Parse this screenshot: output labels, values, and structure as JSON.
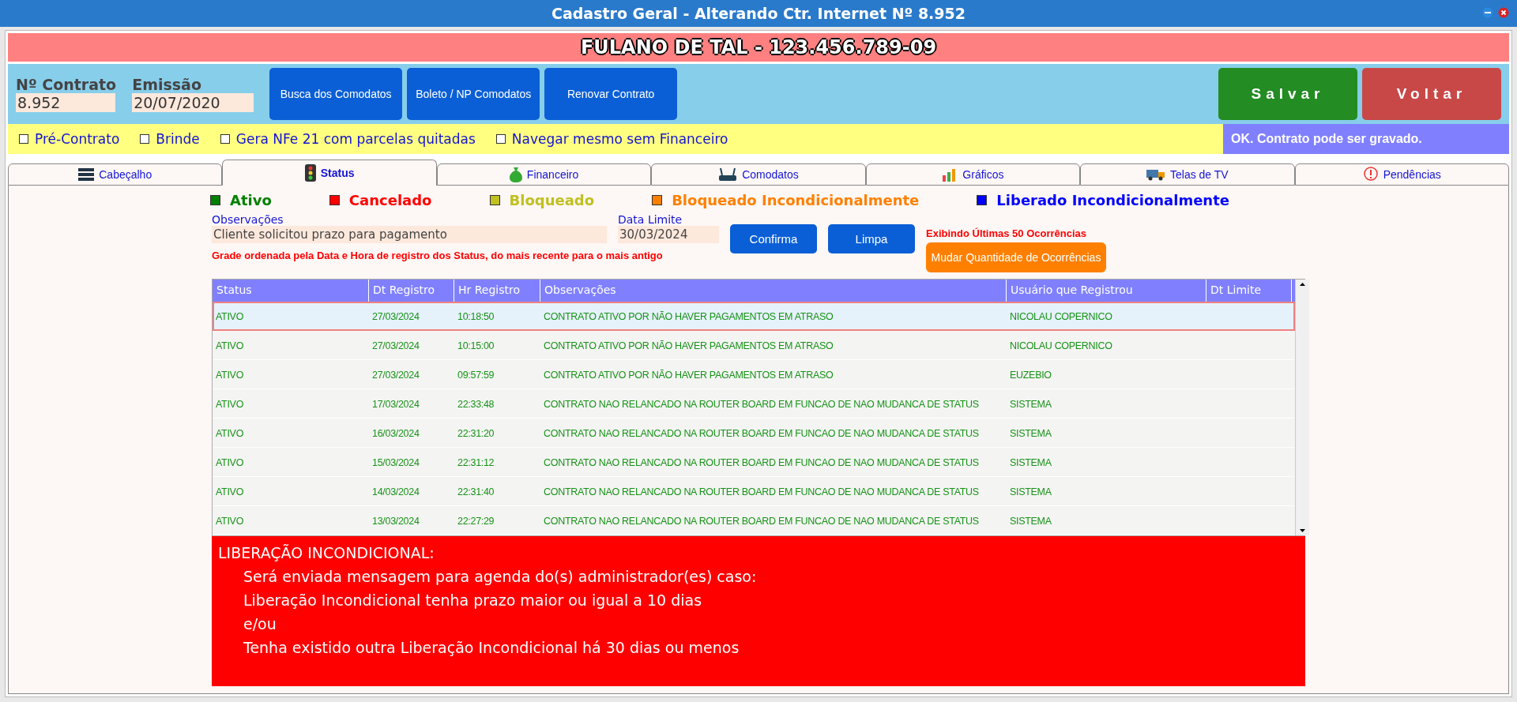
{
  "window": {
    "title": "Cadastro Geral - Alterando Ctr. Internet Nº 8.952"
  },
  "client_banner": "FULANO DE TAL - 123.456.789-09",
  "header": {
    "fields": [
      {
        "label": "Nº Contrato",
        "value": "8.952"
      },
      {
        "label": "Emissão",
        "value": "20/07/2020"
      }
    ],
    "buttons": [
      "Busca dos Comodatos",
      "Boleto / NP Comodatos",
      "Renovar Contrato"
    ],
    "save_button": "Salvar",
    "back_button": "Voltar"
  },
  "options": [
    {
      "label": "Pré-Contrato",
      "checked": false
    },
    {
      "label": "Brinde",
      "checked": false
    },
    {
      "label": "Gera NFe 21 com parcelas quitadas",
      "checked": false
    },
    {
      "label": "Navegar mesmo sem Financeiro",
      "checked": false
    }
  ],
  "status_message": "OK. Contrato pode ser gravado.",
  "tabs": [
    {
      "label": "Cabeçalho",
      "selected": false
    },
    {
      "label": "Status",
      "selected": true
    },
    {
      "label": "Financeiro",
      "selected": false
    },
    {
      "label": "Comodatos",
      "selected": false
    },
    {
      "label": "Gráficos",
      "selected": false
    },
    {
      "label": "Telas de TV",
      "selected": false
    },
    {
      "label": "Pendências",
      "selected": false
    }
  ],
  "legend": [
    {
      "label": "Ativo",
      "color": "#008000"
    },
    {
      "label": "Cancelado",
      "color": "#ff0000"
    },
    {
      "label": "Bloqueado",
      "color": "#c0c020"
    },
    {
      "label": "Bloqueado Incondicionalmente",
      "color": "#ff8000"
    },
    {
      "label": "Liberado Incondicionalmente",
      "color": "#0000ff"
    }
  ],
  "observacoes": {
    "label": "Observações",
    "value": "Cliente solicitou prazo para pagamento"
  },
  "data_limite": {
    "label": "Data Limite",
    "value": "30/03/2024"
  },
  "confirm_button": "Confirma",
  "clear_button": "Limpa",
  "occurrences_note": "Exibindo Últimas 50 Ocorrências",
  "change_quantity_button": "Mudar Quantidade de Ocorrências",
  "grid_note": "Grade ordenada pela Data e Hora de registro dos Status, do mais recente para o mais antigo",
  "table": {
    "columns": [
      "Status",
      "Dt Registro",
      "Hr Registro",
      "Observações",
      "Usuário que Registrou",
      "Dt Limite"
    ],
    "rows": [
      {
        "cells": [
          "ATIVO",
          "27/03/2024",
          "10:18:50",
          "CONTRATO ATIVO POR NÃO HAVER PAGAMENTOS EM ATRASO",
          "NICOLAU COPERNICO"
        ],
        "selected": true
      },
      {
        "cells": [
          "ATIVO",
          "27/03/2024",
          "10:15:00",
          "CONTRATO ATIVO POR NÃO HAVER PAGAMENTOS EM ATRASO",
          "NICOLAU COPERNICO"
        ],
        "selected": false
      },
      {
        "cells": [
          "ATIVO",
          "27/03/2024",
          "09:57:59",
          "CONTRATO ATIVO POR NÃO HAVER PAGAMENTOS EM ATRASO",
          "EUZEBIO"
        ],
        "selected": false
      },
      {
        "cells": [
          "ATIVO",
          "17/03/2024",
          "22:33:48",
          "CONTRATO NAO RELANCADO NA ROUTER BOARD EM FUNCAO DE NAO MUDANCA DE STATUS",
          "SISTEMA"
        ],
        "selected": false
      },
      {
        "cells": [
          "ATIVO",
          "16/03/2024",
          "22:31:20",
          "CONTRATO NAO RELANCADO NA ROUTER BOARD EM FUNCAO DE NAO MUDANCA DE STATUS",
          "SISTEMA"
        ],
        "selected": false
      },
      {
        "cells": [
          "ATIVO",
          "15/03/2024",
          "22:31:12",
          "CONTRATO NAO RELANCADO NA ROUTER BOARD EM FUNCAO DE NAO MUDANCA DE STATUS",
          "SISTEMA"
        ],
        "selected": false
      },
      {
        "cells": [
          "ATIVO",
          "14/03/2024",
          "22:31:40",
          "CONTRATO NAO RELANCADO NA ROUTER BOARD EM FUNCAO DE NAO MUDANCA DE STATUS",
          "SISTEMA"
        ],
        "selected": false
      },
      {
        "cells": [
          "ATIVO",
          "13/03/2024",
          "22:27:29",
          "CONTRATO NAO RELANCADO NA ROUTER BOARD EM FUNCAO DE NAO MUDANCA DE STATUS",
          "SISTEMA"
        ],
        "selected": false
      }
    ]
  },
  "notice": {
    "title": "LIBERAÇÃO INCONDICIONAL:",
    "lines": [
      "Será enviada mensagem para agenda do(s) administrador(es) caso:",
      "Liberação Incondicional tenha prazo maior ou igual a 10 dias",
      "e/ou",
      "Tenha existido outra Liberação Incondicional há 30 dias ou menos"
    ]
  }
}
